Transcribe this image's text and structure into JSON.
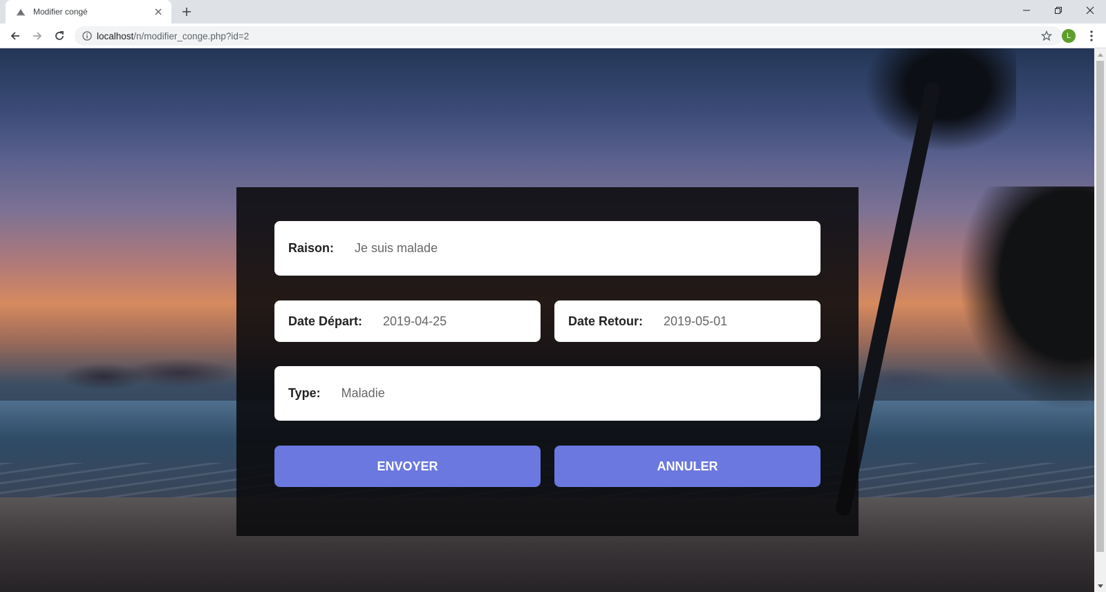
{
  "browser": {
    "tab_title": "Modifier congé",
    "url_host": "localhost",
    "url_path": "/n/modifier_conge.php?id=2",
    "profile_initial": "L",
    "profile_color": "#5e9e2f"
  },
  "form": {
    "raison": {
      "label": "Raison:",
      "value": "Je suis malade"
    },
    "date_depart": {
      "label": "Date Départ:",
      "value": "2019-04-25"
    },
    "date_retour": {
      "label": "Date Retour:",
      "value": "2019-05-01"
    },
    "type": {
      "label": "Type:",
      "value": "Maladie"
    },
    "submit_label": "ENVOYER",
    "cancel_label": "ANNULER",
    "button_color": "#6b78df"
  },
  "icons": {
    "favicon": "page-favicon-icon",
    "tab_close": "close-icon",
    "new_tab": "plus-icon",
    "back": "arrow-left-icon",
    "forward": "arrow-right-icon",
    "reload": "reload-icon",
    "site_info": "info-icon",
    "bookmark": "star-icon",
    "menu": "kebab-menu-icon",
    "minimize": "minimize-icon",
    "restore": "restore-icon",
    "close_window": "close-window-icon"
  }
}
